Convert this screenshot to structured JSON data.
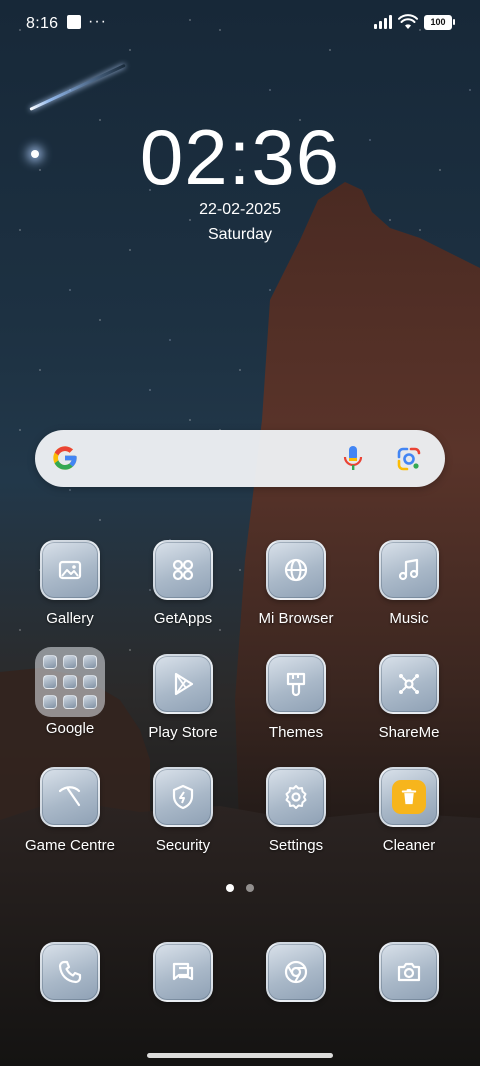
{
  "status_bar": {
    "time": "8:16",
    "dots": "···",
    "battery": "100"
  },
  "clock": {
    "time": "02:36",
    "date": "22-02-2025",
    "day": "Saturday"
  },
  "search": {
    "g": "G"
  },
  "rows": [
    [
      {
        "label": "Gallery",
        "icon": "gallery-icon"
      },
      {
        "label": "GetApps",
        "icon": "getapps-icon"
      },
      {
        "label": "Mi Browser",
        "icon": "globe-icon"
      },
      {
        "label": "Music",
        "icon": "music-note-icon"
      }
    ],
    [
      {
        "label": "Google",
        "icon": "folder-icon"
      },
      {
        "label": "Play Store",
        "icon": "play-icon"
      },
      {
        "label": "Themes",
        "icon": "brush-icon"
      },
      {
        "label": "ShareMe",
        "icon": "share-nodes-icon"
      }
    ],
    [
      {
        "label": "Game Centre",
        "icon": "game-icon"
      },
      {
        "label": "Security",
        "icon": "shield-icon"
      },
      {
        "label": "Settings",
        "icon": "gear-icon"
      },
      {
        "label": "Cleaner",
        "icon": "trash-icon"
      }
    ]
  ],
  "pager": {
    "pages": 2,
    "active": 1
  },
  "dock": [
    {
      "icon": "phone-icon"
    },
    {
      "icon": "messages-icon"
    },
    {
      "icon": "chrome-icon"
    },
    {
      "icon": "camera-icon"
    }
  ],
  "colors": {
    "tile": "#a9b8c8",
    "cleaner": "#f7b51c",
    "google_blue": "#4285F4",
    "google_red": "#EA4335",
    "google_yellow": "#FBBC05",
    "google_green": "#34A853"
  }
}
